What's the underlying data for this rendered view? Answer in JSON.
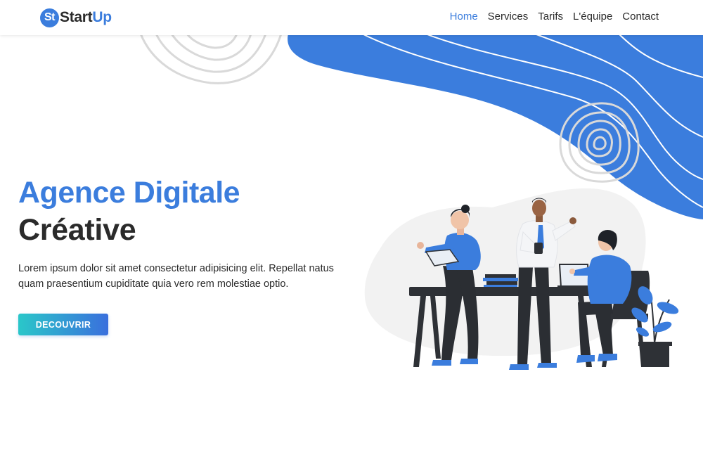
{
  "brand": {
    "badge": "St",
    "name_part1": "Start",
    "name_part2": "Up"
  },
  "nav": [
    {
      "label": "Home",
      "active": true
    },
    {
      "label": "Services",
      "active": false
    },
    {
      "label": "Tarifs",
      "active": false
    },
    {
      "label": "L'équipe",
      "active": false
    },
    {
      "label": "Contact",
      "active": false
    }
  ],
  "hero": {
    "title_line1": "Agence Digitale",
    "title_line2": "Créative",
    "description": "Lorem ipsum dolor sit amet consectetur adipisicing elit. Repellat natus quam praesentium cupiditate quia vero rem molestiae optio.",
    "cta_label": "DECOUVRIR"
  },
  "colors": {
    "accent": "#3b7ddd",
    "text_dark": "#2b2b2b",
    "gradient_start": "#2ac7c9",
    "gradient_end": "#3a6fdd"
  }
}
